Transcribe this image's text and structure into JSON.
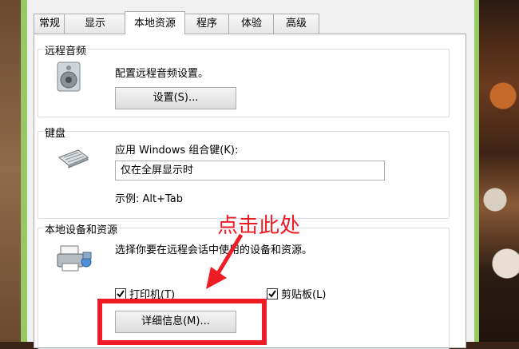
{
  "tabs": [
    "常规",
    "显示",
    "本地资源",
    "程序",
    "体验",
    "高级"
  ],
  "active_tab": "本地资源",
  "remote_audio": {
    "title": "远程音频",
    "description": "配置远程音频设置。",
    "settings_button": "设置(S)..."
  },
  "keyboard": {
    "title": "键盘",
    "combo_label": "应用 Windows 组合键(K):",
    "combo_value": "仅在全屏显示时",
    "example": "示例: Alt+Tab"
  },
  "local_devices": {
    "title": "本地设备和资源",
    "description": "选择你要在远程会话中使用的设备和资源。",
    "printers_label": "打印机(T)",
    "printers_checked": true,
    "clipboard_label": "剪贴板(L)",
    "clipboard_checked": true,
    "more_button": "详细信息(M)..."
  },
  "annotation": {
    "text": "点击此处",
    "color": "#ee1c25"
  },
  "icons": [
    "speaker-icon",
    "keyboard-icon",
    "printer-icon",
    "dropdown-arrow-icon",
    "checkmark-icon",
    "red-arrow-annotation"
  ]
}
